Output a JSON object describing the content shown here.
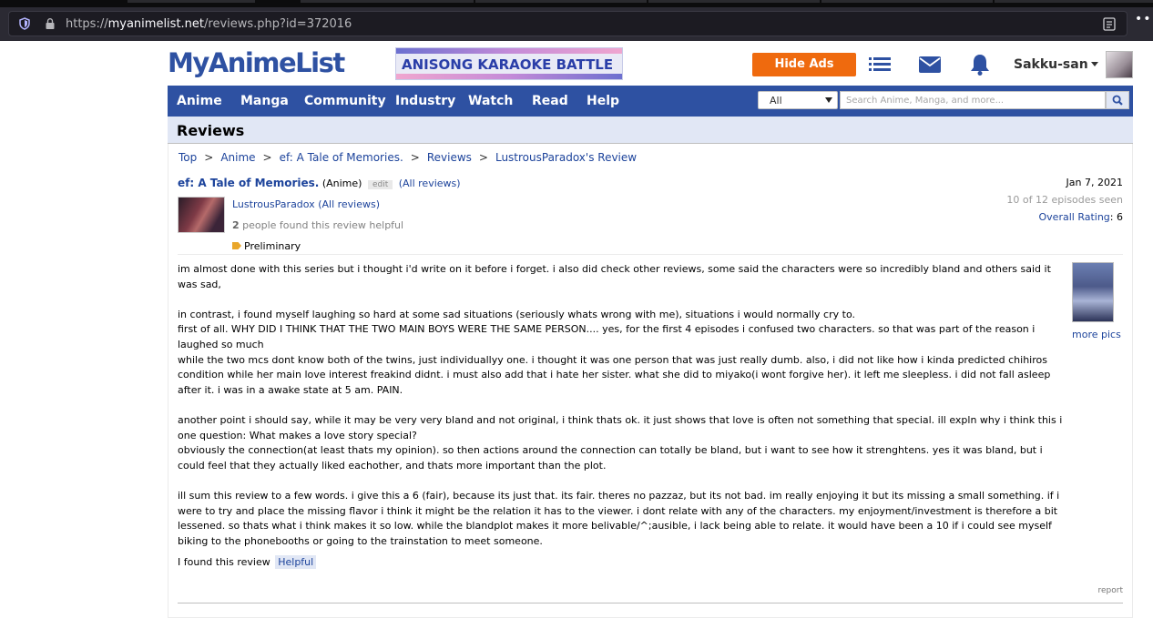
{
  "browser": {
    "url_prefix": "https://",
    "url_host": "myanimelist.net",
    "url_path": "/reviews.php?id=372016"
  },
  "header": {
    "logo": "MyAnimeList",
    "banner_text": "ANISONG KARAOKE BATTLE",
    "hide_ads": "Hide Ads",
    "username": "Sakku-san"
  },
  "nav": {
    "items": [
      "Anime",
      "Manga",
      "Community",
      "Industry",
      "Watch",
      "Read",
      "Help"
    ],
    "search_type": "All",
    "search_placeholder": "Search Anime, Manga, and more..."
  },
  "page": {
    "title": "Reviews",
    "breadcrumbs": [
      "Top",
      "Anime",
      "ef: A Tale of Memories.",
      "Reviews",
      "LustrousParadox's Review"
    ],
    "breadcrumb_sep": ">"
  },
  "review": {
    "anime_title": "ef: A Tale of Memories.",
    "anime_type": "(Anime)",
    "edit_label": "edit",
    "all_reviews_anime": "(All reviews)",
    "date": "Jan 7, 2021",
    "episodes_seen": "10 of 12 episodes seen",
    "overall_label": "Overall Rating",
    "overall_value": ": 6",
    "reviewer": "LustrousParadox",
    "reviewer_all_reviews": "(All reviews)",
    "helpful_count": "2",
    "helpful_text": " people found this review helpful",
    "tag": "Preliminary",
    "paragraphs": [
      "im almost done with this series but i thought i'd write on it before i forget. i also did check other reviews, some said the characters were so incredibly bland and others said it was sad,",
      "",
      "in contrast, i found myself laughing so hard at some sad situations (seriously whats wrong with me), situations i would normally cry to.",
      "first of all. WHY DID I THINK THAT THE TWO MAIN BOYS WERE THE SAME PERSON.... yes, for the first 4 episodes i confused two characters. so that was part of the reason i laughed so much",
      "while the two mcs dont know both of the twins, just individuallyy one. i thought it was one person that was just really dumb. also, i did not like how i kinda predicted chihiros condition while her main love interest freakind didnt. i must also add that i hate her sister. what she did to miyako(i wont forgive her). it left me sleepless. i did not fall asleep after it. i was in a awake state at 5 am. PAIN.",
      "",
      "another point i should say, while it may be very very bland and not original, i think thats ok. it just shows that love is often not something that special. ill expln why i think this i one question: What makes a love story special?",
      "obviously the connection(at least thats my opinion). so then actions around the connection can totally be bland, but i want to see how it strenghtens. yes it was bland, but i could feel that they actually liked eachother, and thats more important than the plot.",
      "",
      "ill sum this review to a few words. i give this a 6 (fair), because its just that. its fair. theres no pazzaz, but its not bad. im really enjoying it but its missing a small something. if i were to try and place the missing flavor i think it might be the relation it has to the viewer. i dont relate with any of the characters. my enjoyment/investment is therefore a bit lessened. so thats what i think makes it so low. while the blandplot makes it more belivable/^;ausible, i lack being able to relate. it would have been a 10 if i could see myself biking to the phonebooths or going to the trainstation to meet someone."
    ],
    "more_pics": "more pics",
    "found_text": "I found this review",
    "helpful_button": "Helpful",
    "report": "report"
  },
  "colors": {
    "brand_blue": "#2e51a2",
    "link_blue": "#1c439b",
    "hide_ads_orange": "#ef6a0e",
    "page_head_bg": "#e1e7f5"
  }
}
